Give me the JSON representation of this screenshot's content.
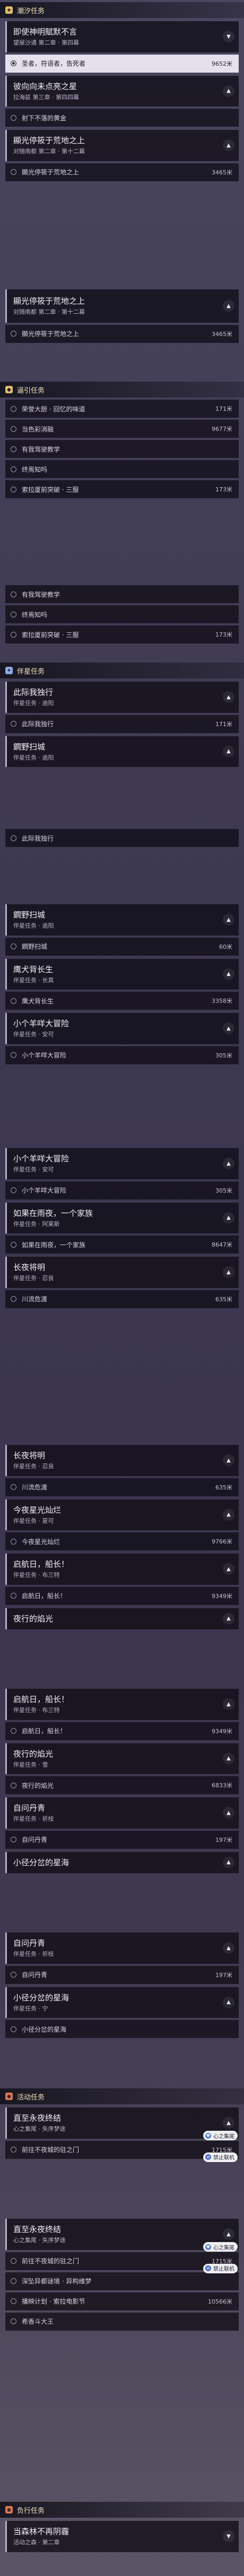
{
  "colors": {
    "main_quest": "#e0bd6a",
    "side_quest": "#8ea8e6",
    "event_quest": "#e07a54"
  },
  "sections": {
    "main": "潮汐任务",
    "daily": "逼引任务",
    "side": "伴星任务",
    "event": "活动任务",
    "event2": "负行任务"
  },
  "quests": {
    "q1": {
      "title": "即使神明賦默不言",
      "sub": "望屋沙通 第二章 · 第四幕"
    },
    "q2": {
      "title": "彼向向未点亮之星",
      "sub": "拉海兹 第三章 · 第四四幕"
    },
    "q3": {
      "title": "顯光停筱于荒地之上",
      "sub": "对随南都 第二章 · 第十二幕"
    },
    "q4": {
      "title": "此际我独行",
      "sub": "伴星任务 · 逾阳"
    },
    "q5": {
      "title": "鐧野扫城",
      "sub": "伴星任务 · 逾阳"
    },
    "q6": {
      "title": "鹰犬背长生",
      "sub": "伴星任务 · 长真"
    },
    "q7": {
      "title": "小个羊咩大冒险",
      "sub": "伴星任务 · 安可"
    },
    "q8": {
      "title": "如果在雨夜，一个家族",
      "sub": "伴星任务 · 阿莱斯"
    },
    "q9": {
      "title": "长夜将明",
      "sub": "伴星任务 · 忍良"
    },
    "q10": {
      "title": "今夜星光灿烂",
      "sub": "伴星任务 · 夏可"
    },
    "q11": {
      "title": "启航日，船长！",
      "sub": "伴星任务 · 布三特"
    },
    "q12": {
      "title": "夜行的焰光",
      "sub": "伴星任务 · 雪"
    },
    "q13": {
      "title": "自问丹青",
      "sub": "伴星任务 · 祈枝"
    },
    "q14": {
      "title": "小径分岔的星海",
      "sub": "伴星任务 · 宁"
    },
    "q15": {
      "title": "直至永夜终结",
      "sub": "心之集尾 · 失序梦途"
    },
    "q16": {
      "title": "当森林不再阴霾",
      "sub": "活动之森 · 第二章"
    }
  },
  "steps": {
    "s_a1": {
      "label": "圣者，符语者，告死者",
      "dist": "9652米"
    },
    "s_b1": {
      "label": "射下不落的黄金",
      "dist": ""
    },
    "s_c1": {
      "label": "顯光停筱于荒地之上",
      "dist": "3465米"
    },
    "s_c2": {
      "label": "顯光停筱于荒地之上",
      "dist": "3465米"
    },
    "s_d1": {
      "label": "荣誉大厨 · 回忆的味道",
      "dist": "171米"
    },
    "s_d2": {
      "label": "当色彩消融",
      "dist": "9677米"
    },
    "s_d3": {
      "label": "有我驾驶教学",
      "dist": ""
    },
    "s_d4": {
      "label": "终焉知吗",
      "dist": ""
    },
    "s_d5": {
      "label": "索拉厦前突破 · 三服",
      "dist": "173米"
    },
    "s_d6": {
      "label": "有我驾驶教学",
      "dist": ""
    },
    "s_d7": {
      "label": "终焉知吗",
      "dist": ""
    },
    "s_d8": {
      "label": "索拉厦前突破 · 三服",
      "dist": "173米"
    },
    "s_e1": {
      "label": "此际我独行",
      "dist": "171米"
    },
    "s_e2": {
      "label": "此际我独行",
      "dist": ""
    },
    "s_f1": {
      "label": "鐧野扫城",
      "dist": "60米"
    },
    "s_g1": {
      "label": "鹰犬背长生",
      "dist": "3358米"
    },
    "s_h1": {
      "label": "小个羊咩大冒险",
      "dist": "305米"
    },
    "s_h2": {
      "label": "小个羊咩大冒险",
      "dist": "305米"
    },
    "s_i1": {
      "label": "如果在雨夜，一个家族",
      "dist": "8647米"
    },
    "s_j1": {
      "label": "川流危渡",
      "dist": "635米"
    },
    "s_j2": {
      "label": "川流危渡",
      "dist": "635米"
    },
    "s_k1": {
      "label": "今夜星光灿烂",
      "dist": "9766米"
    },
    "s_l1": {
      "label": "启航日，船长！",
      "dist": "9349米"
    },
    "s_l2": {
      "label": "启航日，船长！",
      "dist": "9349米"
    },
    "s_m1": {
      "label": "夜行的焰光",
      "dist": "6833米"
    },
    "s_n1": {
      "label": "自问丹青",
      "dist": "197米"
    },
    "s_n2": {
      "label": "自问丹青",
      "dist": "197米"
    },
    "s_o1": {
      "label": "小径分岔的星海",
      "dist": ""
    },
    "s_p1": {
      "label": "前往不夜城的驻之门",
      "dist": "1715米"
    },
    "s_p2": {
      "label": "前往不夜城的驻之门",
      "dist": "1715米"
    },
    "s_p3": {
      "label": "深坠异都谜境 · 异构维梦",
      "dist": ""
    },
    "s_p4": {
      "label": "播映计划 · 索拉电影节",
      "dist": "10566米"
    },
    "s_p5": {
      "label": "希香斗大王",
      "dist": ""
    }
  },
  "tags": {
    "heart_icon": "心之集尾",
    "forbid": "禁止联机"
  }
}
